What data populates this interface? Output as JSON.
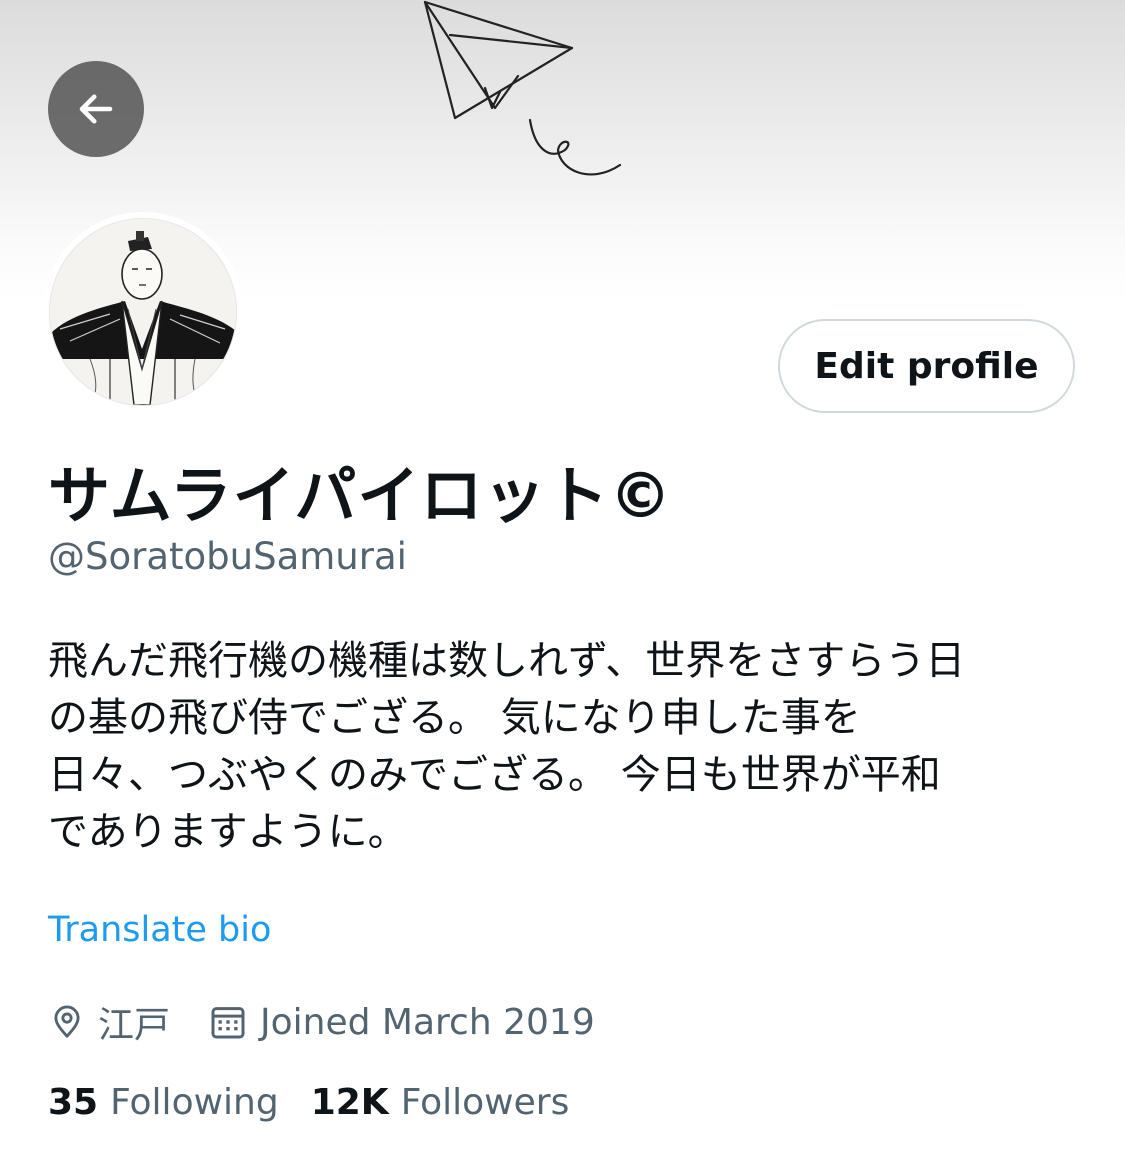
{
  "header": {
    "back_icon": "arrow-left-icon",
    "banner_art": "paper-plane-doodle"
  },
  "profile": {
    "display_name": "サムライパイロット©",
    "handle": "@SoratobuSamurai",
    "edit_label": "Edit profile",
    "bio_lines": [
      "飛んだ飛行機の機種は数しれず、世界をさすらう日",
      "の基の飛び侍でござる。 気になり申した事を",
      "日々、つぶやくのみでござる。 今日も世界が平和",
      "でありますように。"
    ],
    "translate_label": "Translate bio",
    "location": "江戸",
    "location_icon": "location-pin-icon",
    "joined": "Joined March 2019",
    "joined_icon": "calendar-icon",
    "following_count": "35",
    "following_label": "Following",
    "followers_count": "12K",
    "followers_label": "Followers"
  },
  "colors": {
    "link": "#1d9bf0",
    "secondary_text": "#536471",
    "primary_text": "#0f1419",
    "button_border": "#cfd9de"
  }
}
